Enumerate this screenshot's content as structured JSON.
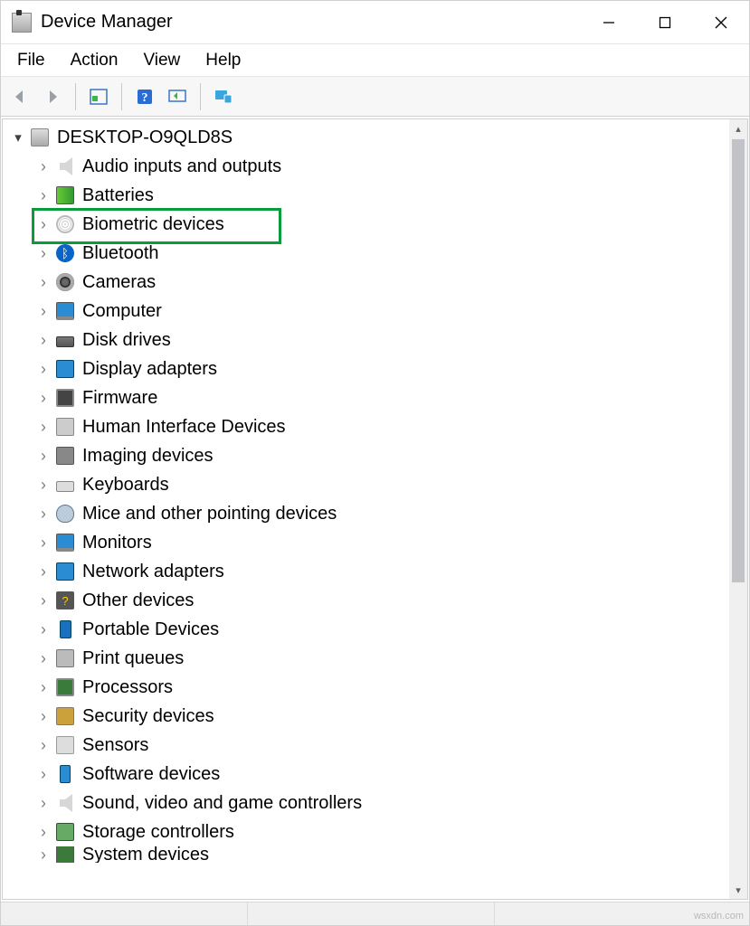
{
  "window": {
    "title": "Device Manager"
  },
  "menu": {
    "file": "File",
    "action": "Action",
    "view": "View",
    "help": "Help"
  },
  "toolbar_icons": {
    "back": "back-arrow",
    "forward": "forward-arrow",
    "show_hidden": "properties-pane",
    "help": "help",
    "scan": "scan-hardware",
    "devices_view": "devices-and-printers"
  },
  "tree": {
    "root": "DESKTOP-O9QLD8S",
    "categories": [
      {
        "id": "audio",
        "label": "Audio inputs and outputs",
        "icon": "speaker-icon"
      },
      {
        "id": "batteries",
        "label": "Batteries",
        "icon": "battery-icon"
      },
      {
        "id": "biometric",
        "label": "Biometric devices",
        "icon": "fingerprint-icon",
        "highlighted": true
      },
      {
        "id": "bluetooth",
        "label": "Bluetooth",
        "icon": "bluetooth-icon"
      },
      {
        "id": "cameras",
        "label": "Cameras",
        "icon": "camera-icon"
      },
      {
        "id": "computer",
        "label": "Computer",
        "icon": "monitor-icon"
      },
      {
        "id": "diskdrives",
        "label": "Disk drives",
        "icon": "hdd-icon"
      },
      {
        "id": "display",
        "label": "Display adapters",
        "icon": "gpu-icon"
      },
      {
        "id": "firmware",
        "label": "Firmware",
        "icon": "chip-icon"
      },
      {
        "id": "hid",
        "label": "Human Interface Devices",
        "icon": "hid-icon"
      },
      {
        "id": "imaging",
        "label": "Imaging devices",
        "icon": "imaging-icon"
      },
      {
        "id": "keyboards",
        "label": "Keyboards",
        "icon": "keyboard-icon"
      },
      {
        "id": "mice",
        "label": "Mice and other pointing devices",
        "icon": "mouse-icon"
      },
      {
        "id": "monitors",
        "label": "Monitors",
        "icon": "display-icon"
      },
      {
        "id": "network",
        "label": "Network adapters",
        "icon": "nic-icon"
      },
      {
        "id": "other",
        "label": "Other devices",
        "icon": "unknown-device-icon"
      },
      {
        "id": "portable",
        "label": "Portable Devices",
        "icon": "portable-icon"
      },
      {
        "id": "print",
        "label": "Print queues",
        "icon": "printer-icon"
      },
      {
        "id": "processors",
        "label": "Processors",
        "icon": "cpu-icon"
      },
      {
        "id": "security",
        "label": "Security devices",
        "icon": "security-icon"
      },
      {
        "id": "sensors",
        "label": "Sensors",
        "icon": "sensor-icon"
      },
      {
        "id": "software",
        "label": "Software devices",
        "icon": "software-icon"
      },
      {
        "id": "sound",
        "label": "Sound, video and game controllers",
        "icon": "sound-icon"
      },
      {
        "id": "storage",
        "label": "Storage controllers",
        "icon": "storage-icon"
      },
      {
        "id": "system",
        "label": "System devices",
        "icon": "system-icon",
        "cutoff": true
      }
    ]
  },
  "watermark": "wsxdn.com"
}
